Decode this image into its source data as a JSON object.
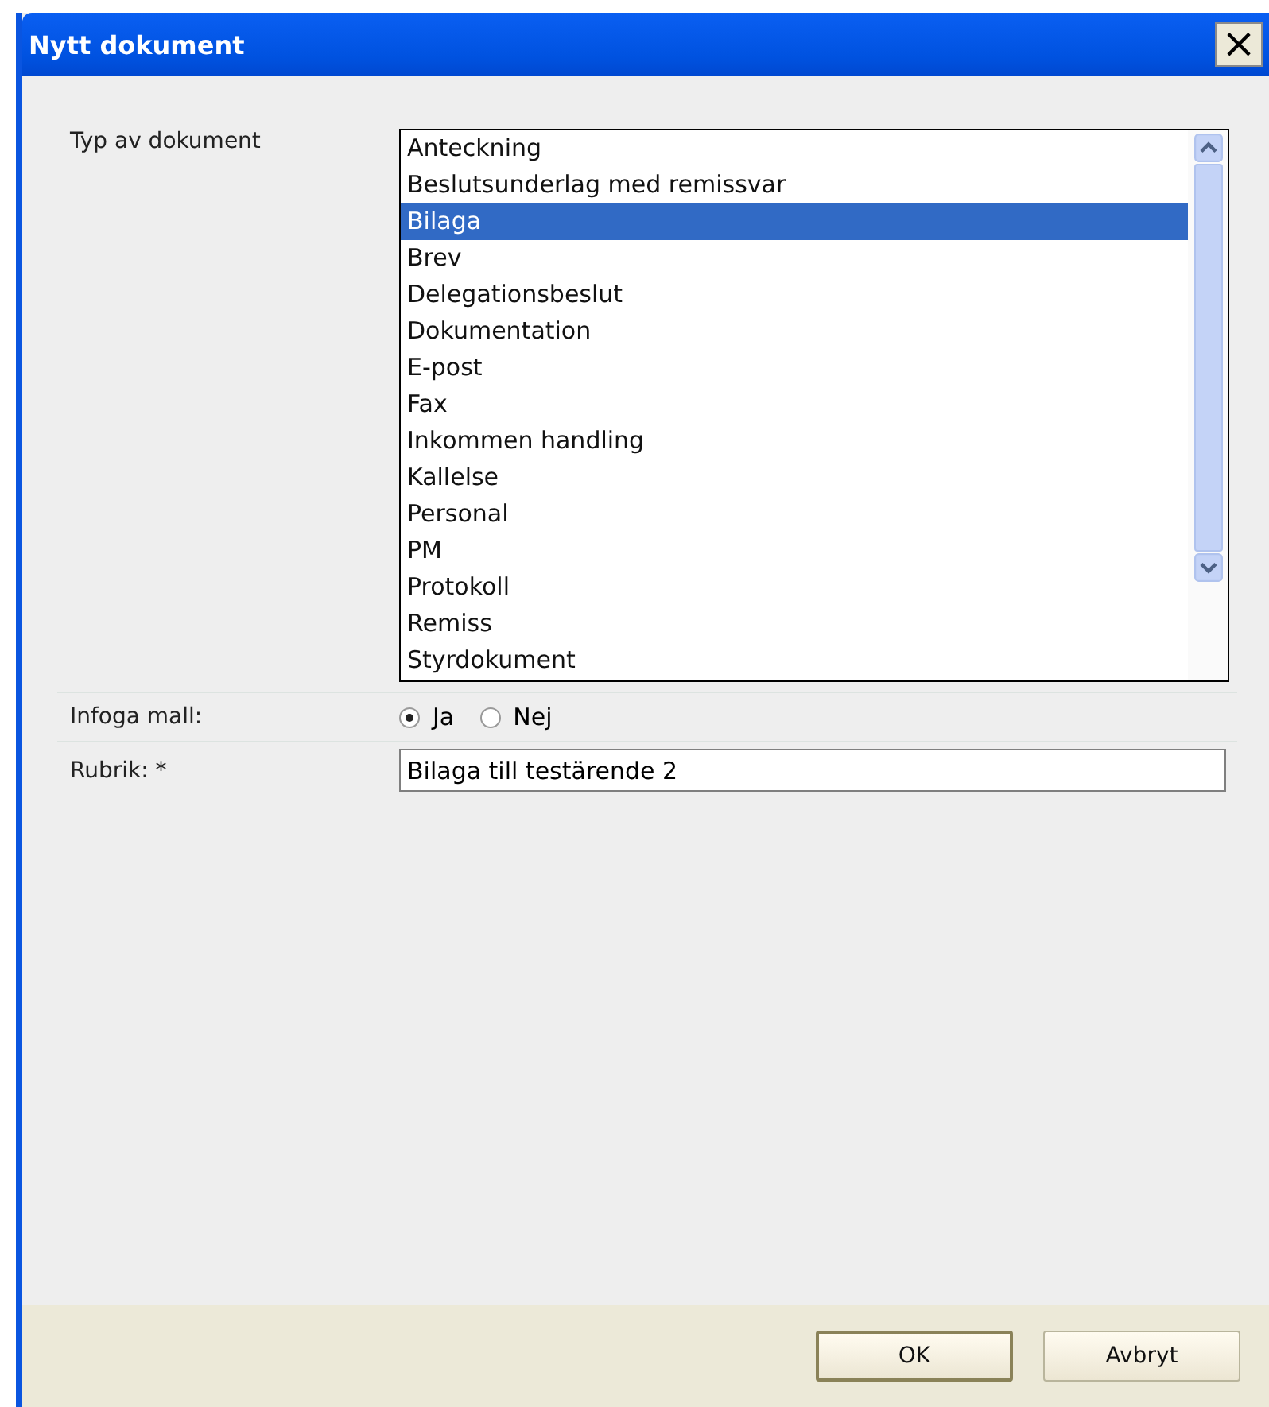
{
  "window": {
    "title": "Nytt dokument",
    "close": "×"
  },
  "form": {
    "type_label": "Typ av dokument",
    "types": [
      {
        "label": "Anteckning",
        "selected": false
      },
      {
        "label": "Beslutsunderlag med remissvar",
        "selected": false
      },
      {
        "label": "Bilaga",
        "selected": true
      },
      {
        "label": "Brev",
        "selected": false
      },
      {
        "label": "Delegationsbeslut",
        "selected": false
      },
      {
        "label": "Dokumentation",
        "selected": false
      },
      {
        "label": "E-post",
        "selected": false
      },
      {
        "label": "Fax",
        "selected": false
      },
      {
        "label": "Inkommen handling",
        "selected": false
      },
      {
        "label": "Kallelse",
        "selected": false
      },
      {
        "label": "Personal",
        "selected": false
      },
      {
        "label": "PM",
        "selected": false
      },
      {
        "label": "Protokoll",
        "selected": false
      },
      {
        "label": "Remiss",
        "selected": false
      },
      {
        "label": "Styrdokument",
        "selected": false
      }
    ],
    "template_label": "Infoga mall:",
    "template_options": [
      {
        "label": "Ja",
        "selected": true
      },
      {
        "label": "Nej",
        "selected": false
      }
    ],
    "title_label": "Rubrik: *",
    "title_value": "Bilaga till testärende 2"
  },
  "buttons": [
    "OK",
    "Avbryt"
  ]
}
